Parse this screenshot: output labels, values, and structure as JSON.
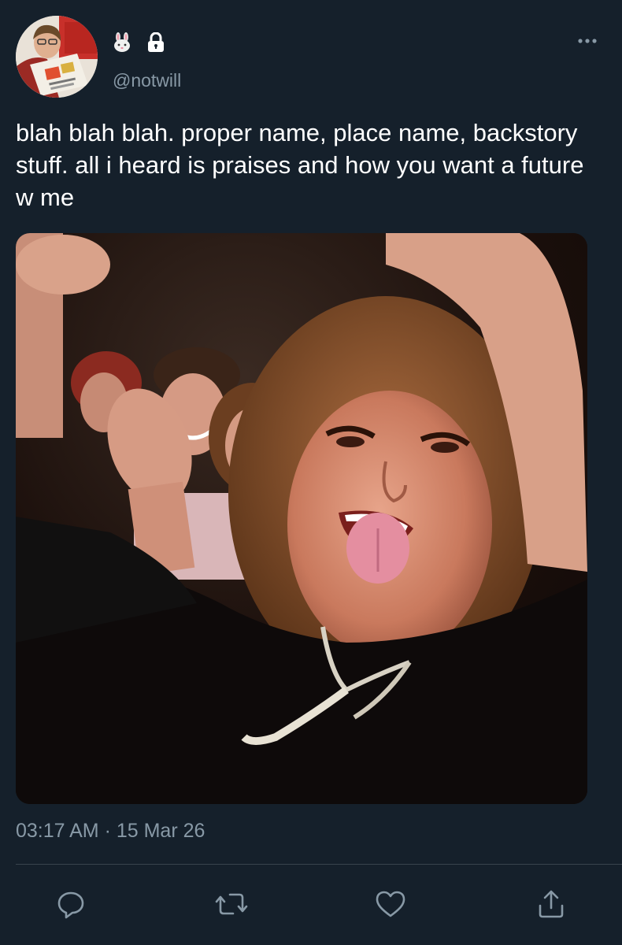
{
  "header": {
    "handle": "@notwill",
    "name_emojis": [
      "rabbit-face",
      "lock"
    ],
    "more_icon": "more-horizontal-icon"
  },
  "tweet": {
    "text": "blah blah blah. proper name, place name, backstory stuff. all i heard is praises and how you want a future w me",
    "time": "03:17 AM",
    "separator": "·",
    "date": "15 Mar 26",
    "timestamp_full": "03:17 AM · 15 Mar 26"
  },
  "actions": [
    {
      "icon": "reply-icon"
    },
    {
      "icon": "retweet-icon"
    },
    {
      "icon": "like-icon"
    },
    {
      "icon": "share-icon"
    }
  ],
  "colors": {
    "background": "#15202b",
    "text_primary": "#ffffff",
    "text_secondary": "#8899a6",
    "divider": "#38444d",
    "icon": "#8899a6"
  }
}
